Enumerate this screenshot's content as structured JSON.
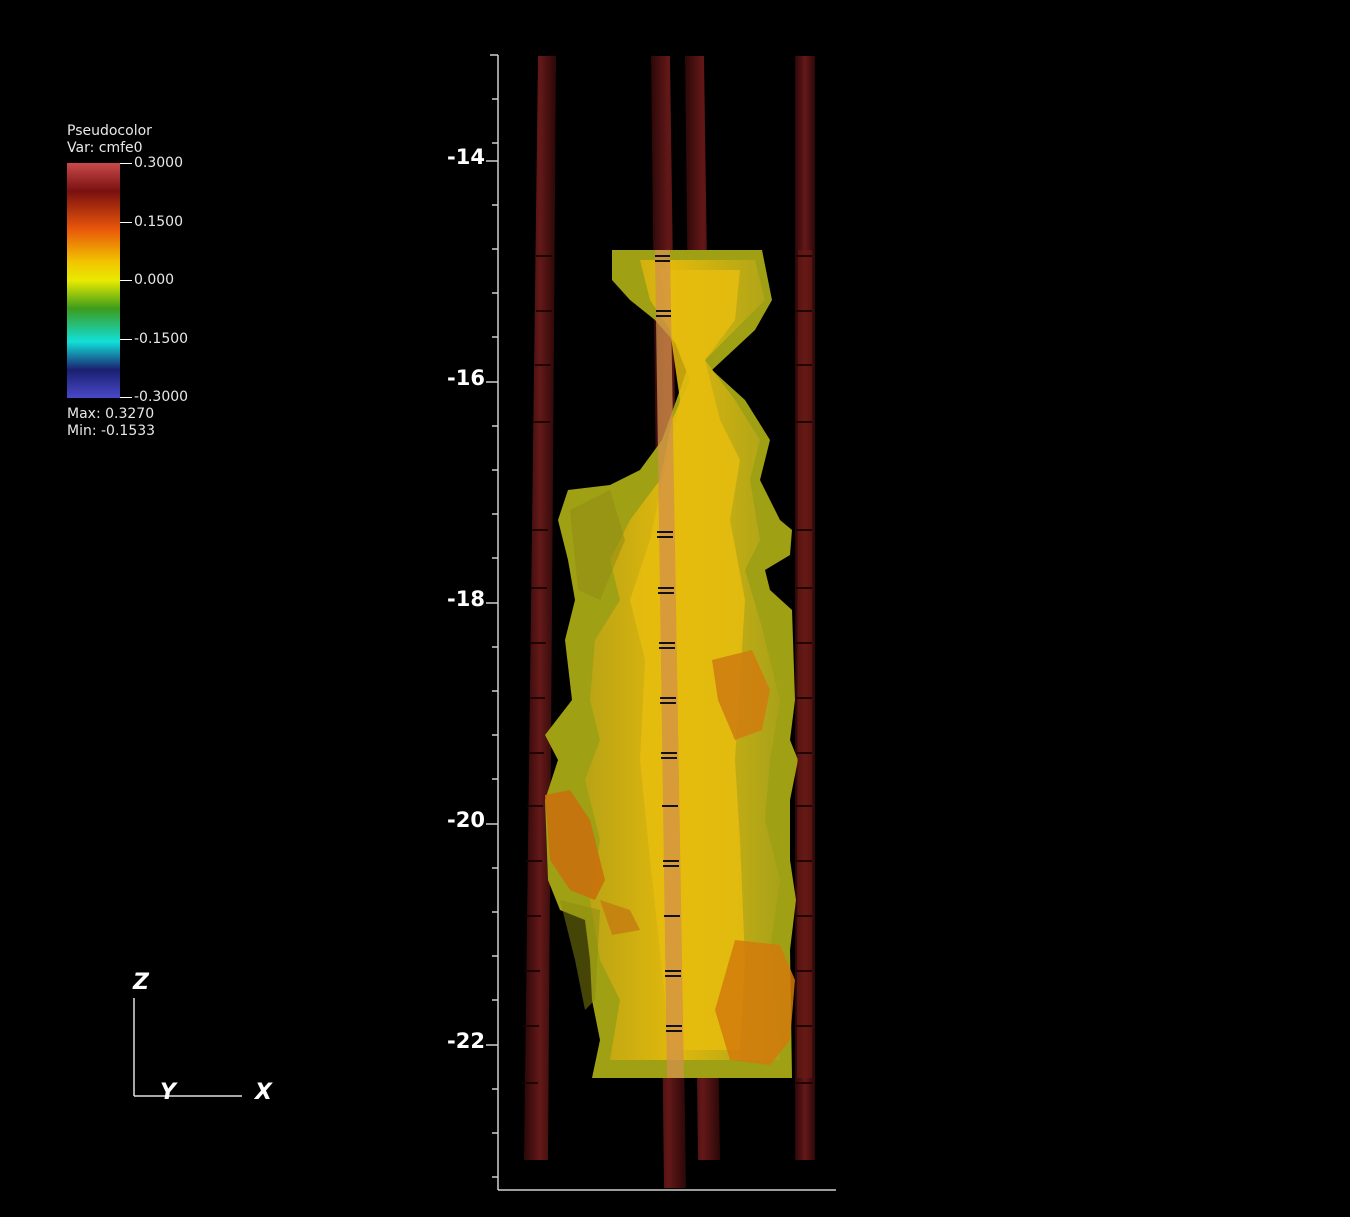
{
  "legend": {
    "title": "Pseudocolor",
    "var": "Var: cmfe0",
    "ticks": [
      "0.3000",
      "0.1500",
      "0.000",
      "-0.1500",
      "-0.3000"
    ],
    "max": "Max:  0.3270",
    "min": "Min: -0.1533"
  },
  "z_axis": {
    "tick_labels": [
      "-14",
      "-16",
      "-18",
      "-20",
      "-22"
    ]
  },
  "triad": {
    "z": "Z",
    "y": "Y",
    "x": "X"
  },
  "colors": {
    "background": "#000000",
    "surface_yellow": "#d8b80a",
    "surface_olive": "#a8a316",
    "surface_orange": "#d2780c",
    "borehole": "#5a1414",
    "legend_gradient": [
      "#c23a3a",
      "#6d0f0f",
      "#e8620a",
      "#f6e800",
      "#3a9a1a",
      "#10e0d0",
      "#1a2a8a",
      "#4444c8"
    ]
  }
}
